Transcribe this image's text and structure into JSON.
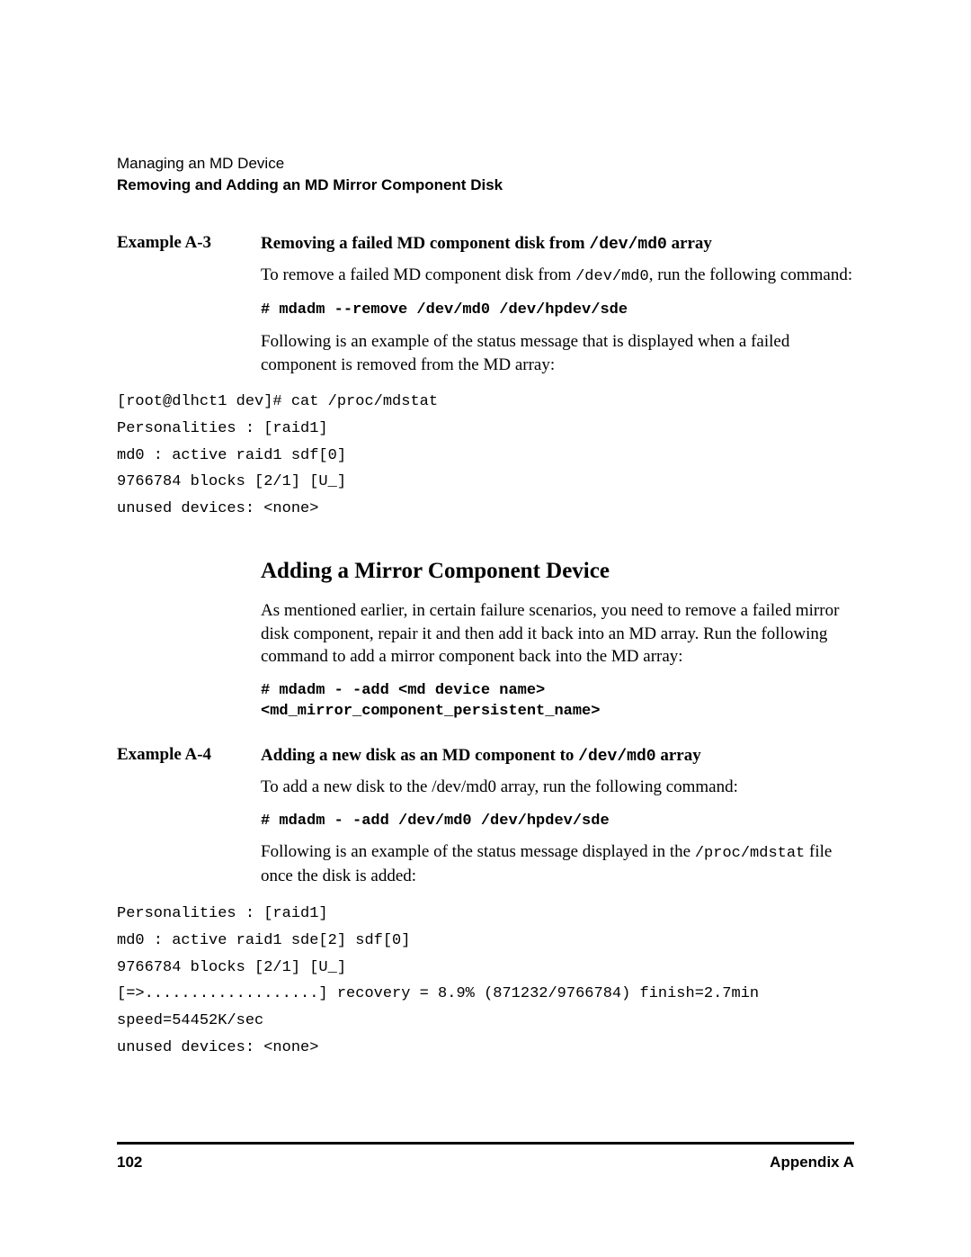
{
  "header": {
    "light": "Managing an MD Device",
    "bold": "Removing and Adding an MD Mirror Component Disk"
  },
  "exA3": {
    "label": "Example A-3",
    "title_pre": "Removing a failed MD component disk from ",
    "title_mono": "/dev/md0",
    "title_post": " array",
    "p1_pre": "To remove a failed MD component disk from ",
    "p1_mono": "/dev/md0",
    "p1_post": ", run the following command:",
    "cmd": "# mdadm --remove /dev/md0 /dev/hpdev/sde",
    "p2": "Following is an example of the status message that is displayed when a failed component is removed from the MD array:"
  },
  "code1": "[root@dlhct1 dev]# cat /proc/mdstat\nPersonalities : [raid1]\nmd0 : active raid1 sdf[0]\n9766784 blocks [2/1] [U_]\nunused devices: <none>",
  "h2": "Adding a Mirror Component Device",
  "adding_intro": "As mentioned earlier, in certain failure scenarios, you need to remove a failed mirror disk component, repair it and then add it back into an MD array. Run the following command to add a mirror component back into the MD array:",
  "adding_cmd": "# mdadm - -add <md device name>\n<md_mirror_component_persistent_name>",
  "exA4": {
    "label": "Example A-4",
    "title_pre": "Adding a new disk as an MD component to ",
    "title_mono": "/dev/md0",
    "title_post": " array",
    "p1": "To add a new disk to the /dev/md0 array, run the following command:",
    "cmd": "# mdadm - -add /dev/md0 /dev/hpdev/sde",
    "p2_pre": "Following is an example of the status message displayed in the ",
    "p2_mono": "/proc/mdstat",
    "p2_post": " file once the disk is added:"
  },
  "code2": "Personalities : [raid1]\nmd0 : active raid1 sde[2] sdf[0]\n9766784 blocks [2/1] [U_]\n[=>...................] recovery = 8.9% (871232/9766784) finish=2.7min\nspeed=54452K/sec\nunused devices: <none>",
  "footer": {
    "page": "102",
    "section": "Appendix A"
  }
}
